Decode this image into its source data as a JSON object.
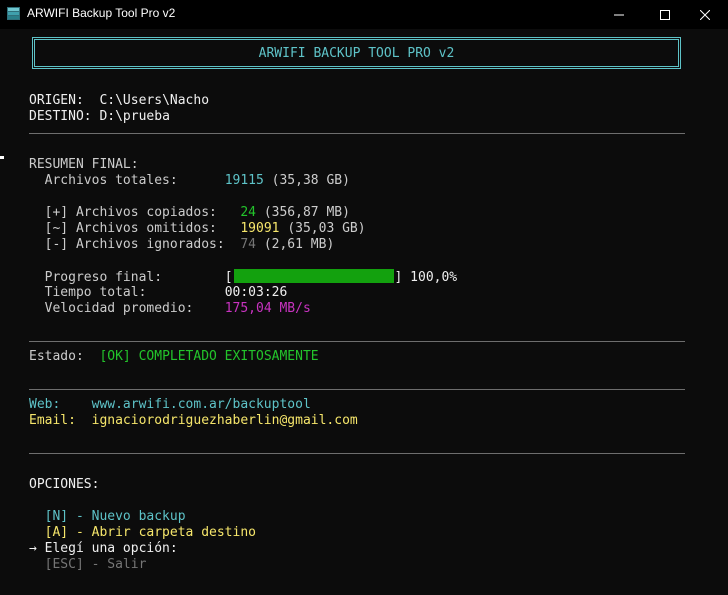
{
  "window": {
    "title": "ARWIFI Backup Tool Pro v2",
    "minimize_icon": "minimize-icon",
    "maximize_icon": "maximize-icon",
    "close_icon": "close-icon"
  },
  "banner": {
    "title": "ARWIFI BACKUP TOOL PRO v2"
  },
  "paths": {
    "origin_label": "ORIGEN:",
    "origin_value": "C:\\Users\\Nacho",
    "dest_label": "DESTINO:",
    "dest_value": "D:\\prueba"
  },
  "summary": {
    "heading": "RESUMEN FINAL:",
    "total_label": "Archivos totales:",
    "total_count": "19115",
    "total_size": "(35,38 GB)",
    "copied_marker": "[+]",
    "copied_label": "Archivos copiados:",
    "copied_count": "24",
    "copied_size": "(356,87 MB)",
    "skipped_marker": "[~]",
    "skipped_label": "Archivos omitidos:",
    "skipped_count": "19091",
    "skipped_size": "(35,03 GB)",
    "ignored_marker": "[-]",
    "ignored_label": "Archivos ignorados:",
    "ignored_count": "74",
    "ignored_size": "(2,61 MB)",
    "progress_label": "Progreso final:",
    "progress_open": "[",
    "progress_close": "]",
    "progress_fraction": 1.0,
    "progress_text": "100,0%",
    "time_label": "Tiempo total:",
    "time_value": "00:03:26",
    "speed_label": "Velocidad promedio:",
    "speed_value": "175,04 MB/s"
  },
  "status": {
    "label": "Estado:",
    "value": "[OK] COMPLETADO EXITOSAMENTE"
  },
  "contact": {
    "web_label": "Web:",
    "web_value": "www.arwifi.com.ar/backuptool",
    "email_label": "Email:",
    "email_value": "ignaciorodriguezhaberlin@gmail.com"
  },
  "options": {
    "heading": "OPCIONES:",
    "new_key": "[N]",
    "new_label": "- Nuevo backup",
    "open_key": "[A]",
    "open_label": "- Abrir carpeta destino",
    "prompt_arrow": "→",
    "prompt_text": "Elegí una opción:",
    "esc_key": "[ESC]",
    "esc_label": "- Salir"
  },
  "colors": {
    "background": "#0c0c0c",
    "accent_cyan": "#5ec3c8",
    "success_green": "#23c42b",
    "progress_green": "#13a10e",
    "warning_yellow": "#f6e66b",
    "speed_magenta": "#c833c0",
    "muted_gray": "#767676"
  }
}
